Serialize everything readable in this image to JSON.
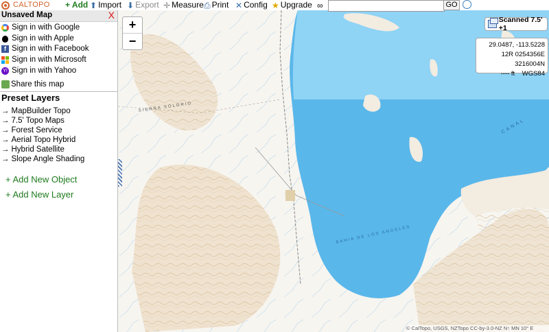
{
  "toolbar": {
    "logo": "CALTOPO",
    "add": "+ Add",
    "import": "Import",
    "export": "Export",
    "measure": "Measure",
    "print": "Print",
    "config": "Config",
    "upgrade": "Upgrade",
    "search_value": "",
    "go": "GO"
  },
  "sidebar": {
    "map_title": "Unsaved Map",
    "close": "X",
    "signin": [
      {
        "label": "Sign in with Google",
        "icon": "google-icon"
      },
      {
        "label": "Sign in with Apple",
        "icon": "apple-icon"
      },
      {
        "label": "Sign in with Facebook",
        "icon": "facebook-icon"
      },
      {
        "label": "Sign in with Microsoft",
        "icon": "microsoft-icon"
      },
      {
        "label": "Sign in with Yahoo",
        "icon": "yahoo-icon"
      }
    ],
    "share": "Share this map",
    "preset_title": "Preset Layers",
    "layers": [
      "MapBuilder Topo",
      "7.5' Topo Maps",
      "Forest Service",
      "Aerial Topo Hybrid",
      "Hybrid Satellite",
      "Slope Angle Shading"
    ],
    "add_object": "+ Add New Object",
    "add_layer": "+ Add New Layer"
  },
  "map": {
    "zoom_in": "+",
    "zoom_out": "−",
    "layer_button": "Scanned 7.5' +1",
    "latlon": "29.0487, -113.5228",
    "utm": "12R 0254356E 3216004N",
    "elevation": "---- ft",
    "datum": "WGS84",
    "labels": {
      "sierra": "SIERRA SOLORIO",
      "bay": "BAHIA DE LOS ANGELES",
      "canal": "CANAL"
    },
    "attribution": "© CalTopo, USGS, NZTopo CC-by-3.0-NZ  N↑ MN 10° E"
  },
  "colors": {
    "water_light": "#8fd3f5",
    "water_deep": "#5ab7ea",
    "land": "#f7f5f0",
    "contour": "#c9a77a",
    "accent_green": "#1f7a1f",
    "close_red": "#dd1111"
  }
}
